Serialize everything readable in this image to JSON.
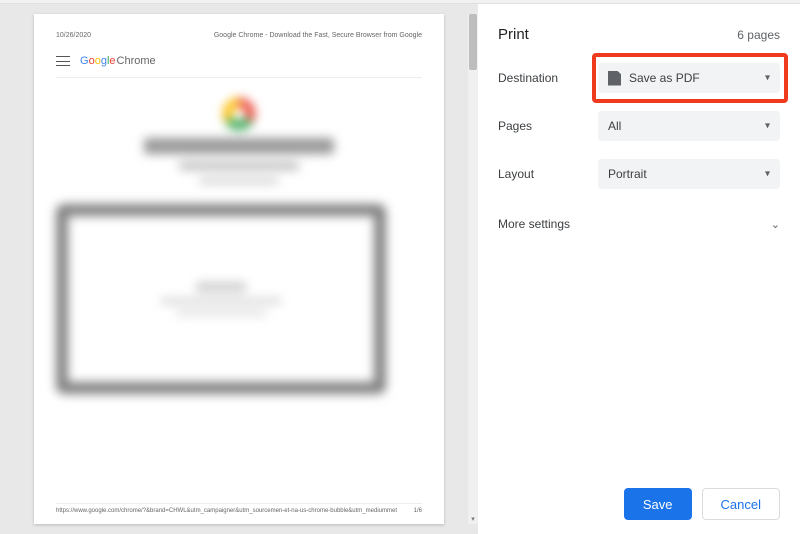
{
  "print": {
    "title": "Print",
    "page_count": "6 pages",
    "fields": {
      "destination": {
        "label": "Destination",
        "value": "Save as PDF"
      },
      "pages": {
        "label": "Pages",
        "value": "All"
      },
      "layout": {
        "label": "Layout",
        "value": "Portrait"
      }
    },
    "more_settings": "More settings",
    "actions": {
      "save": "Save",
      "cancel": "Cancel"
    }
  },
  "preview": {
    "date": "10/26/2020",
    "doc_title": "Google Chrome - Download the Fast, Secure Browser from Google",
    "brand_word": "Google",
    "brand_suffix": "Chrome",
    "footer_url": "https://www.google.com/chrome/?&brand=CHWL&utm_campaigner&utm_sourcemen-et-na-us-chrome-bubble&utm_mediummet",
    "page_indicator": "1/6"
  }
}
